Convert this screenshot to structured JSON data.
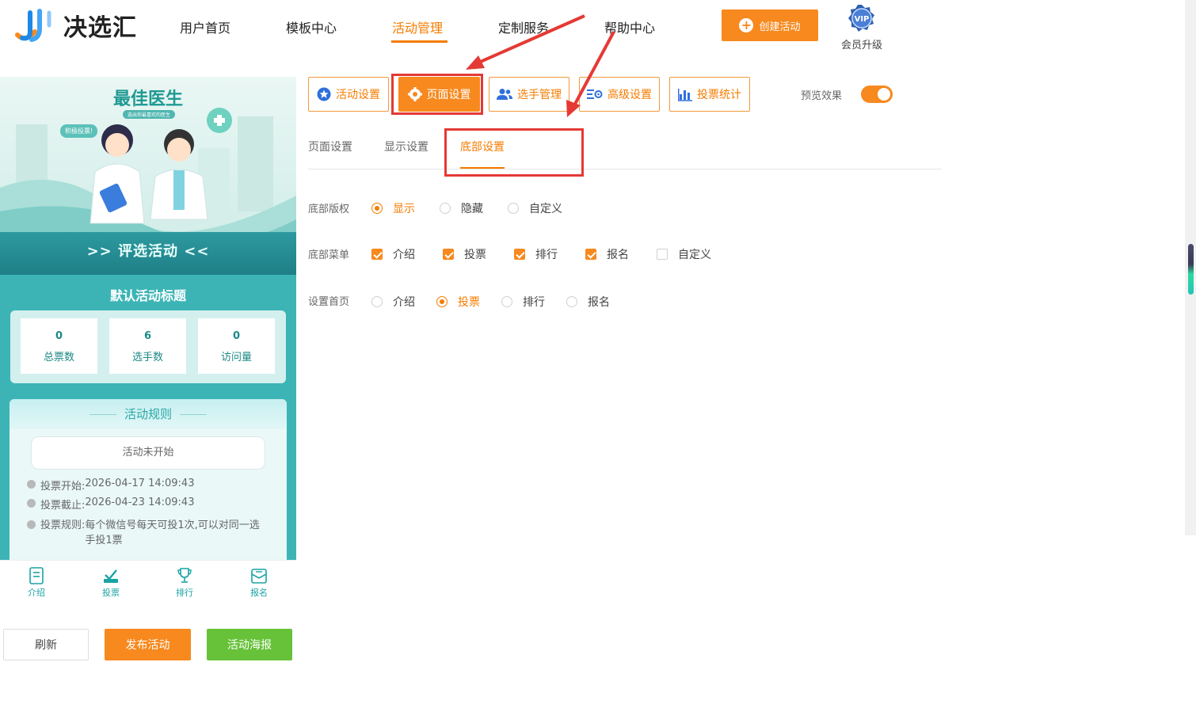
{
  "brand": {
    "name": "决选汇"
  },
  "nav": {
    "items": [
      {
        "label": "用户首页"
      },
      {
        "label": "模板中心"
      },
      {
        "label": "活动管理"
      },
      {
        "label": "定制服务"
      },
      {
        "label": "帮助中心"
      }
    ],
    "active_index": 2,
    "create_button": "创建活动",
    "vip_badge": "VIP",
    "vip_label": "会员升级"
  },
  "preview": {
    "banner_title": "最佳医生",
    "banner_sub": "选出你最喜欢的医生",
    "banner_bubble": "积极投票!",
    "banner_strip": ">> 评选活动 <<",
    "activity_title": "默认活动标题",
    "stats": [
      {
        "value": "0",
        "label": "总票数"
      },
      {
        "value": "6",
        "label": "选手数"
      },
      {
        "value": "0",
        "label": "访问量"
      }
    ],
    "rules_title": "活动规则",
    "status": "活动未开始",
    "rules": [
      {
        "label": "投票开始:",
        "value": "2026-04-17 14:09:43"
      },
      {
        "label": "投票截止:",
        "value": "2026-04-23 14:09:43"
      },
      {
        "label": "投票规则:",
        "value": "每个微信号每天可投1次,可以对同一选手投1票"
      }
    ],
    "tabs": [
      {
        "label": "介绍",
        "icon": "document-icon"
      },
      {
        "label": "投票",
        "icon": "vote-icon"
      },
      {
        "label": "排行",
        "icon": "trophy-icon"
      },
      {
        "label": "报名",
        "icon": "signup-icon"
      }
    ]
  },
  "actions": {
    "refresh": "刷新",
    "publish": "发布活动",
    "poster": "活动海报"
  },
  "toolbar": {
    "buttons": [
      {
        "label": "活动设置",
        "icon": "star-icon"
      },
      {
        "label": "页面设置",
        "icon": "gear-icon"
      },
      {
        "label": "选手管理",
        "icon": "users-icon"
      },
      {
        "label": "高级设置",
        "icon": "advanced-settings-icon"
      },
      {
        "label": "投票统计",
        "icon": "bar-chart-icon"
      }
    ],
    "active_index": 1,
    "preview_label": "预览效果",
    "preview_on": true
  },
  "subtabs": {
    "items": [
      "页面设置",
      "显示设置",
      "底部设置"
    ],
    "active_index": 2
  },
  "settings": {
    "copyright": {
      "label": "底部版权",
      "options": [
        "显示",
        "隐藏",
        "自定义"
      ],
      "selected": 0
    },
    "menu": {
      "label": "底部菜单",
      "options": [
        {
          "label": "介绍",
          "checked": true
        },
        {
          "label": "投票",
          "checked": true
        },
        {
          "label": "排行",
          "checked": true
        },
        {
          "label": "报名",
          "checked": true
        },
        {
          "label": "自定义",
          "checked": false
        }
      ]
    },
    "home": {
      "label": "设置首页",
      "options": [
        "介绍",
        "投票",
        "排行",
        "报名"
      ],
      "selected": 1
    }
  },
  "colors": {
    "accent": "#f7891e",
    "teal": "#3cb4b6",
    "green": "#67c23a",
    "annotation_red": "#e53935"
  }
}
